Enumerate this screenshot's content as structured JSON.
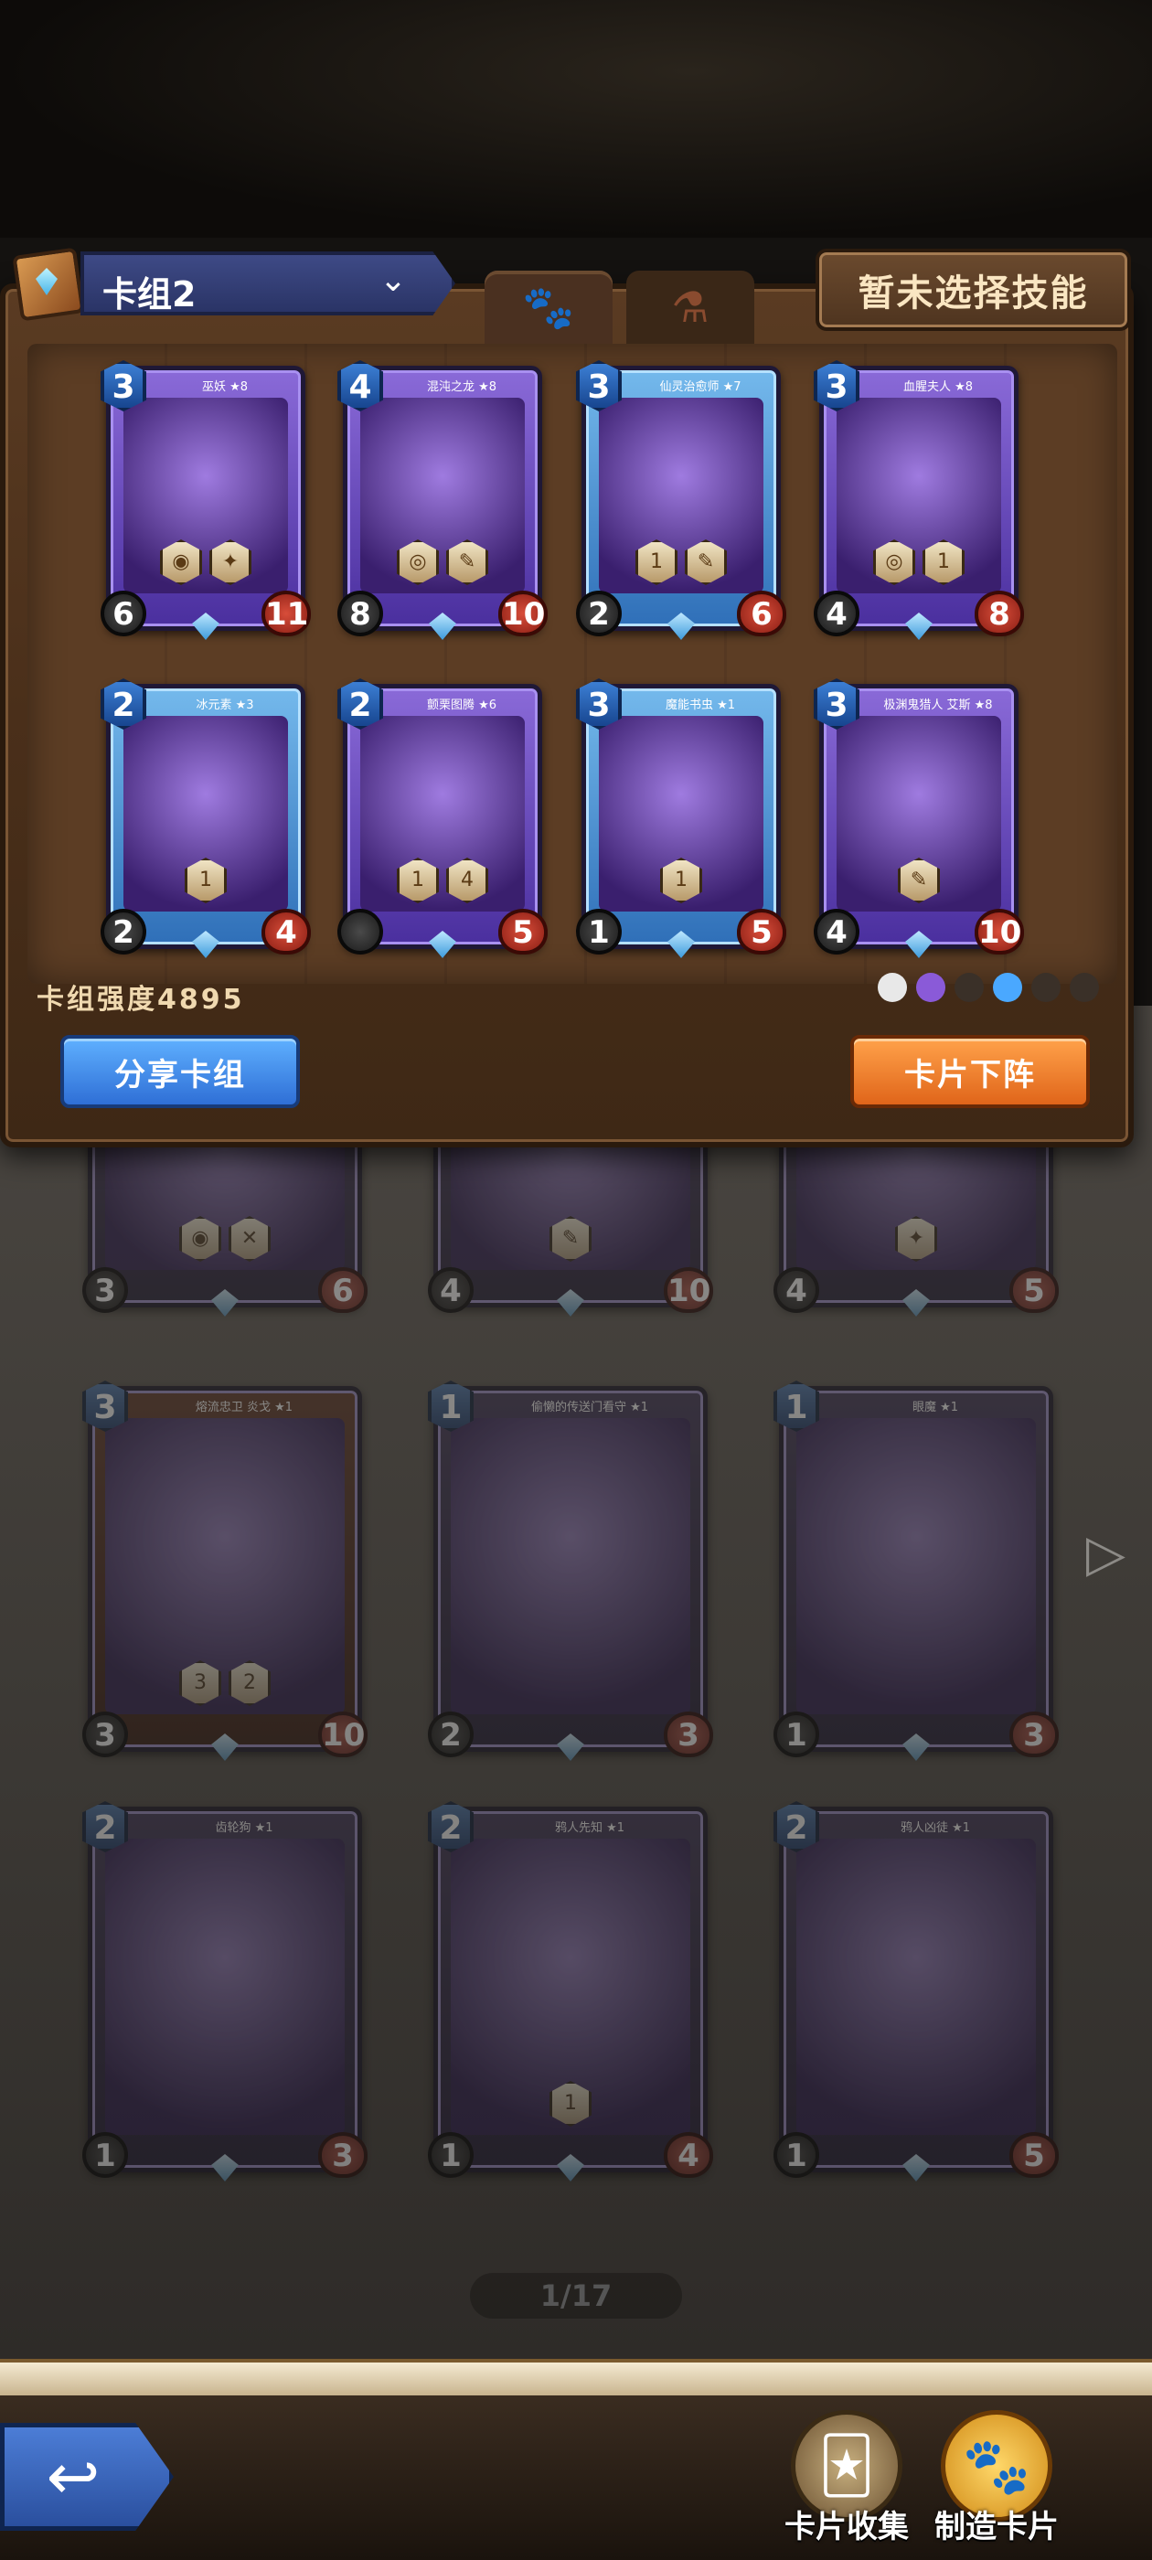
{
  "header": {
    "deck_name": "卡组2",
    "skill_button": "暂未选择技能",
    "tabs": [
      {
        "id": "paw",
        "icon": "paw-icon",
        "glyph": "🐾"
      },
      {
        "id": "potion",
        "icon": "potion-icon",
        "glyph": "⚗"
      }
    ]
  },
  "deck": {
    "cards": [
      {
        "name": "巫妖 ★8",
        "cost": "3",
        "atk": "6",
        "hp": "11",
        "skills": [
          "◉",
          "✦"
        ],
        "style": "purple"
      },
      {
        "name": "混沌之龙 ★8",
        "cost": "4",
        "atk": "8",
        "hp": "10",
        "skills": [
          "◎",
          "✎"
        ],
        "style": "purple"
      },
      {
        "name": "仙灵治愈师 ★7",
        "cost": "3",
        "atk": "2",
        "hp": "6",
        "skills": [
          "1",
          "✎"
        ],
        "style": "blue"
      },
      {
        "name": "血腥夫人 ★8",
        "cost": "3",
        "atk": "4",
        "hp": "8",
        "skills": [
          "◎",
          "1"
        ],
        "style": "purple"
      },
      {
        "name": "冰元素 ★3",
        "cost": "2",
        "atk": "2",
        "hp": "4",
        "skills": [
          "1"
        ],
        "style": "blue"
      },
      {
        "name": "颤栗图腾 ★6",
        "cost": "2",
        "atk": "",
        "hp": "5",
        "skills": [
          "1",
          "4"
        ],
        "style": "purple"
      },
      {
        "name": "魔能书虫 ★1",
        "cost": "3",
        "atk": "1",
        "hp": "5",
        "skills": [
          "1"
        ],
        "style": "blue"
      },
      {
        "name": "极渊鬼猎人 艾斯 ★8",
        "cost": "3",
        "atk": "4",
        "hp": "10",
        "skills": [
          "✎"
        ],
        "style": "purple"
      }
    ],
    "power_label": "卡组强度4895",
    "share_button": "分享卡组",
    "remove_button": "卡片下阵",
    "element_colors": [
      "#e8e8e8",
      "#8a5ad8",
      "#3a3028",
      "#4aa8ff",
      "#3a3028",
      "#3a3028"
    ]
  },
  "collection": {
    "cards": [
      {
        "name": "",
        "cost": "",
        "atk": "3",
        "hp": "6",
        "skills": [
          "◉",
          "✕"
        ],
        "style": "purple"
      },
      {
        "name": "",
        "cost": "",
        "atk": "4",
        "hp": "10",
        "skills": [
          "✎"
        ],
        "style": "purple"
      },
      {
        "name": "",
        "cost": "",
        "atk": "4",
        "hp": "5",
        "skills": [
          "✦"
        ],
        "style": "purple"
      },
      {
        "name": "熔流忠卫 炎戈 ★1",
        "cost": "3",
        "atk": "3",
        "hp": "10",
        "skills": [
          "3",
          "2"
        ],
        "style": "red"
      },
      {
        "name": "偷懒的传送门看守 ★1",
        "cost": "1",
        "atk": "2",
        "hp": "3",
        "skills": [],
        "style": "purple"
      },
      {
        "name": "眼魔 ★1",
        "cost": "1",
        "atk": "1",
        "hp": "3",
        "skills": [],
        "style": "purple"
      },
      {
        "name": "齿轮狗 ★1",
        "cost": "2",
        "atk": "1",
        "hp": "3",
        "skills": [],
        "style": "purple"
      },
      {
        "name": "鸦人先知 ★1",
        "cost": "2",
        "atk": "1",
        "hp": "4",
        "skills": [
          "1"
        ],
        "style": "purple"
      },
      {
        "name": "鸦人凶徒 ★1",
        "cost": "2",
        "atk": "1",
        "hp": "5",
        "skills": [],
        "style": "purple"
      }
    ],
    "pager": "1/17"
  },
  "bottom_nav": {
    "collect_label": "卡片收集",
    "craft_label": "制造卡片",
    "back_glyph": "↩"
  }
}
